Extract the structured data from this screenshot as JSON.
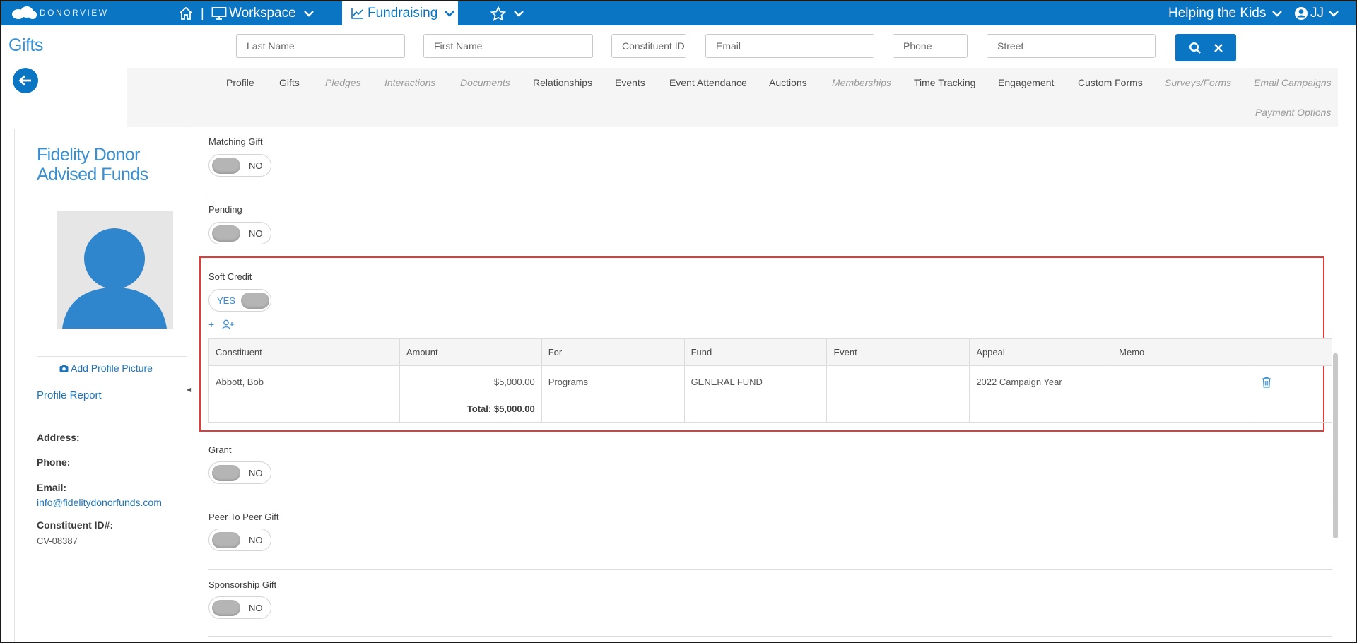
{
  "topbar": {
    "logo_text": "DONORVIEW",
    "workspace_label": "Workspace",
    "fundraising_label": "Fundraising",
    "org_label": "Helping the Kids",
    "user_initials": "JJ"
  },
  "page": {
    "title": "Gifts"
  },
  "search": {
    "last_name_placeholder": "Last Name",
    "first_name_placeholder": "First Name",
    "constituent_id_placeholder": "Constituent ID",
    "email_placeholder": "Email",
    "phone_placeholder": "Phone",
    "street_placeholder": "Street"
  },
  "nav": {
    "tabs": [
      {
        "label": "Profile",
        "disabled": false
      },
      {
        "label": "Gifts",
        "disabled": false
      },
      {
        "label": "Pledges",
        "disabled": true
      },
      {
        "label": "Interactions",
        "disabled": true
      },
      {
        "label": "Documents",
        "disabled": true
      },
      {
        "label": "Relationships",
        "disabled": false
      },
      {
        "label": "Events",
        "disabled": false
      },
      {
        "label": "Event Attendance",
        "disabled": false
      },
      {
        "label": "Auctions",
        "disabled": false
      },
      {
        "label": "Memberships",
        "disabled": true
      },
      {
        "label": "Time Tracking",
        "disabled": false
      },
      {
        "label": "Engagement",
        "disabled": false
      },
      {
        "label": "Custom Forms",
        "disabled": false
      },
      {
        "label": "Surveys/Forms",
        "disabled": true
      },
      {
        "label": "Email Campaigns",
        "disabled": true
      },
      {
        "label": "Payment Options",
        "disabled": true
      }
    ]
  },
  "profile": {
    "name": "Fidelity Donor Advised Funds",
    "add_picture_label": "Add Profile Picture",
    "report_label": "Profile Report",
    "address_label": "Address:",
    "phone_label": "Phone:",
    "email_label": "Email:",
    "email_value": "info@fidelitydonorfunds.com",
    "constituent_id_label": "Constituent ID#:",
    "constituent_id_value": "CV-08387"
  },
  "fields": {
    "matching_gift": {
      "label": "Matching Gift",
      "state": "NO"
    },
    "pending": {
      "label": "Pending",
      "state": "NO"
    },
    "soft_credit": {
      "label": "Soft Credit",
      "state": "YES"
    },
    "grant": {
      "label": "Grant",
      "state": "NO"
    },
    "peer_to_peer": {
      "label": "Peer To Peer Gift",
      "state": "NO"
    },
    "sponsorship": {
      "label": "Sponsorship Gift",
      "state": "NO"
    }
  },
  "soft_credit_table": {
    "add_label": "+",
    "columns": [
      "Constituent",
      "Amount",
      "For",
      "Fund",
      "Event",
      "Appeal",
      "Memo"
    ],
    "row": {
      "constituent": "Abbott, Bob",
      "amount": "$5,000.00",
      "for": "Programs",
      "fund": "GENERAL FUND",
      "event": "",
      "appeal": "2022 Campaign Year",
      "memo": ""
    },
    "total": "Total: $5,000.00"
  },
  "colors": {
    "brand_blue": "#0a75c2",
    "link_blue": "#1f74b8",
    "highlight_red": "#e23b3b"
  }
}
